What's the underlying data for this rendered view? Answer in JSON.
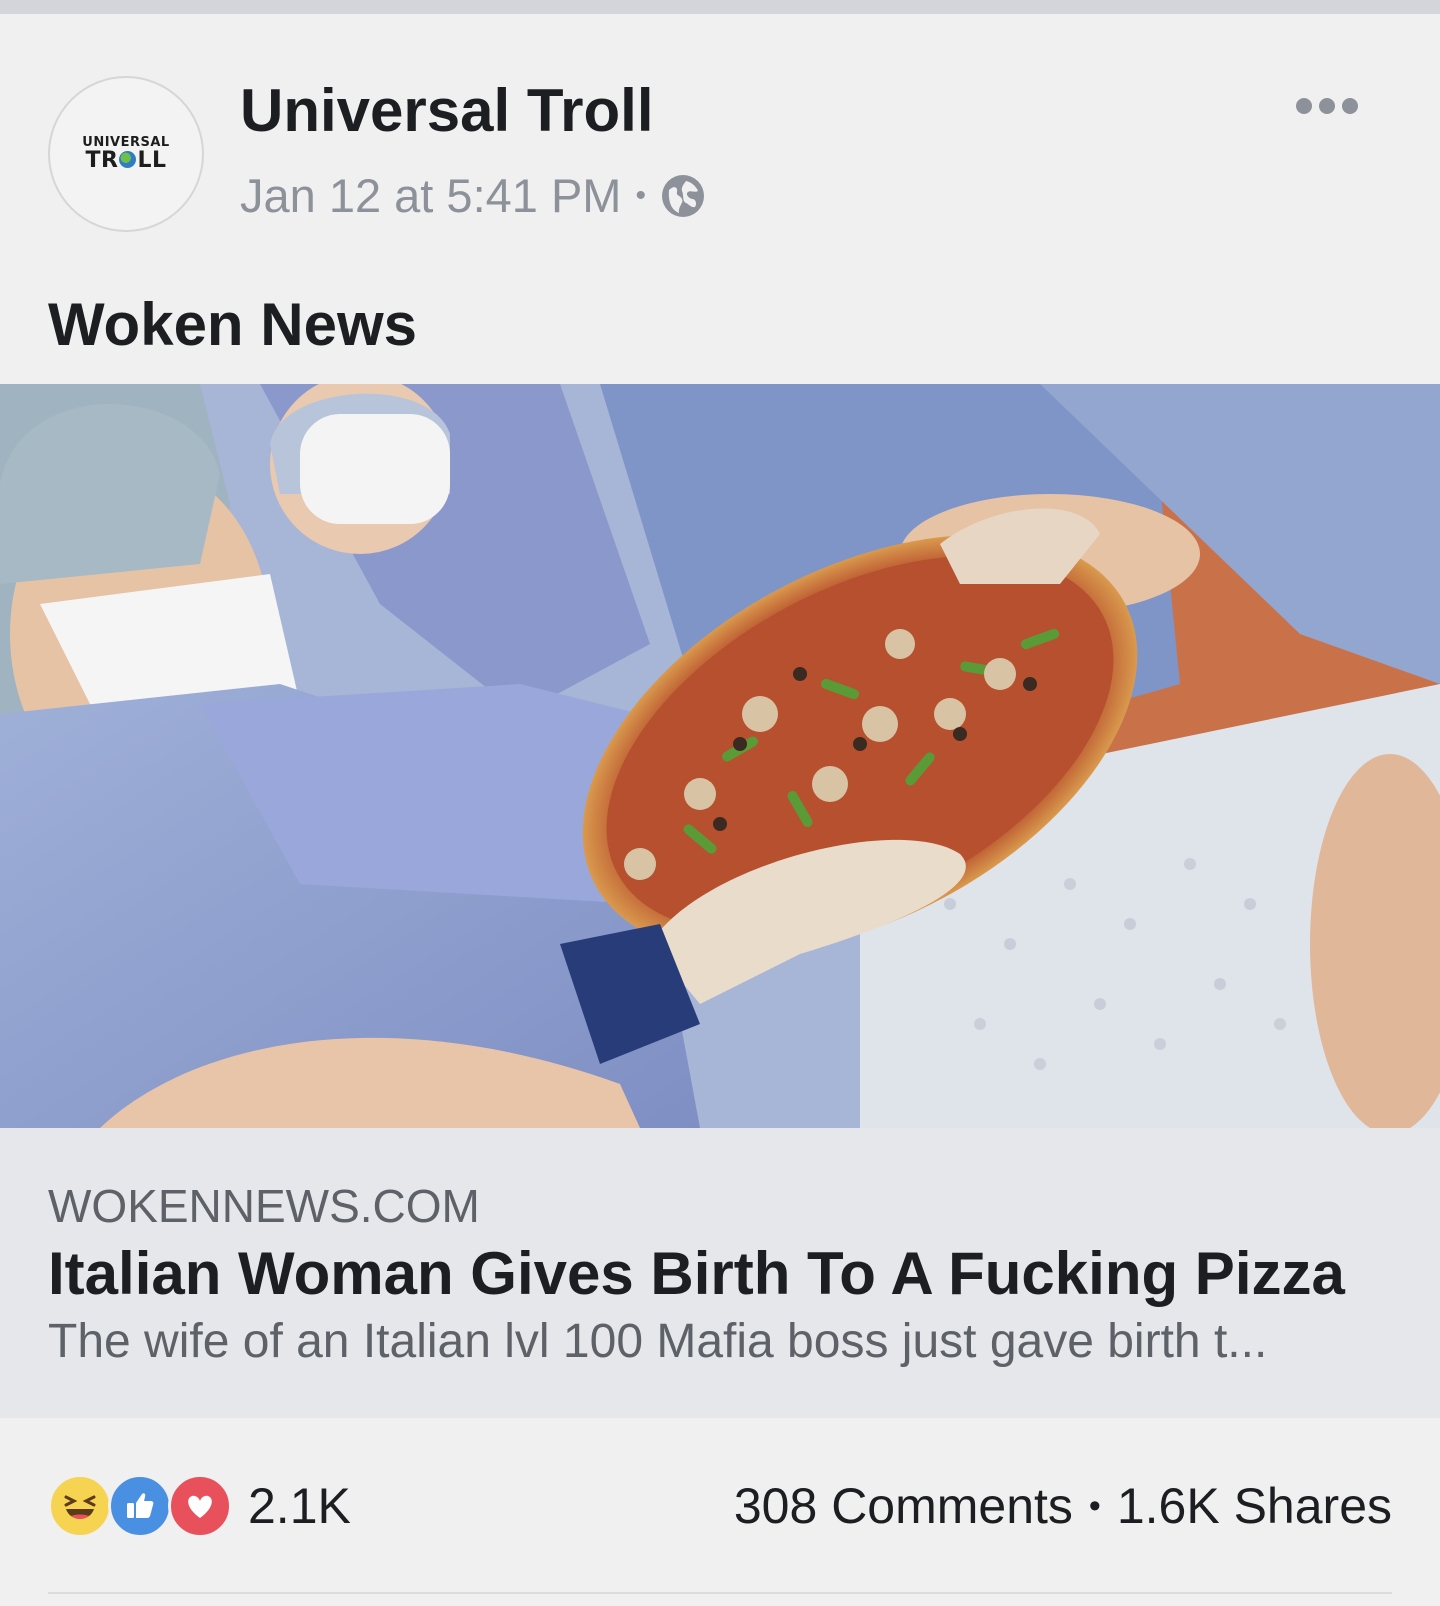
{
  "post": {
    "page_name": "Universal Troll",
    "avatar_logo": {
      "line1": "UNIVERSAL",
      "line2_a": "TR",
      "line2_b": "LL"
    },
    "timestamp": "Jan 12 at 5:41 PM",
    "separator": "•",
    "privacy_icon": "globe-icon",
    "more_icon": "more-options-icon",
    "text": "Woken News"
  },
  "link_preview": {
    "image_description_icon": "photo",
    "domain": "WOKENNEWS.COM",
    "title": "Italian Woman Gives Birth To A Fucking Pizza",
    "description": "The wife of an Italian lvl 100 Mafia boss just gave birth t..."
  },
  "engagement": {
    "reaction_icons": [
      "haha-reaction-icon",
      "like-reaction-icon",
      "love-reaction-icon"
    ],
    "reaction_count": "2.1K",
    "comments": "308 Comments",
    "separator": "•",
    "shares": "1.6K Shares"
  },
  "colors": {
    "like_blue": "#4a90e2",
    "love_red": "#e8505b",
    "haha_yellow": "#f7d352",
    "secondary_text": "#8d929a"
  }
}
